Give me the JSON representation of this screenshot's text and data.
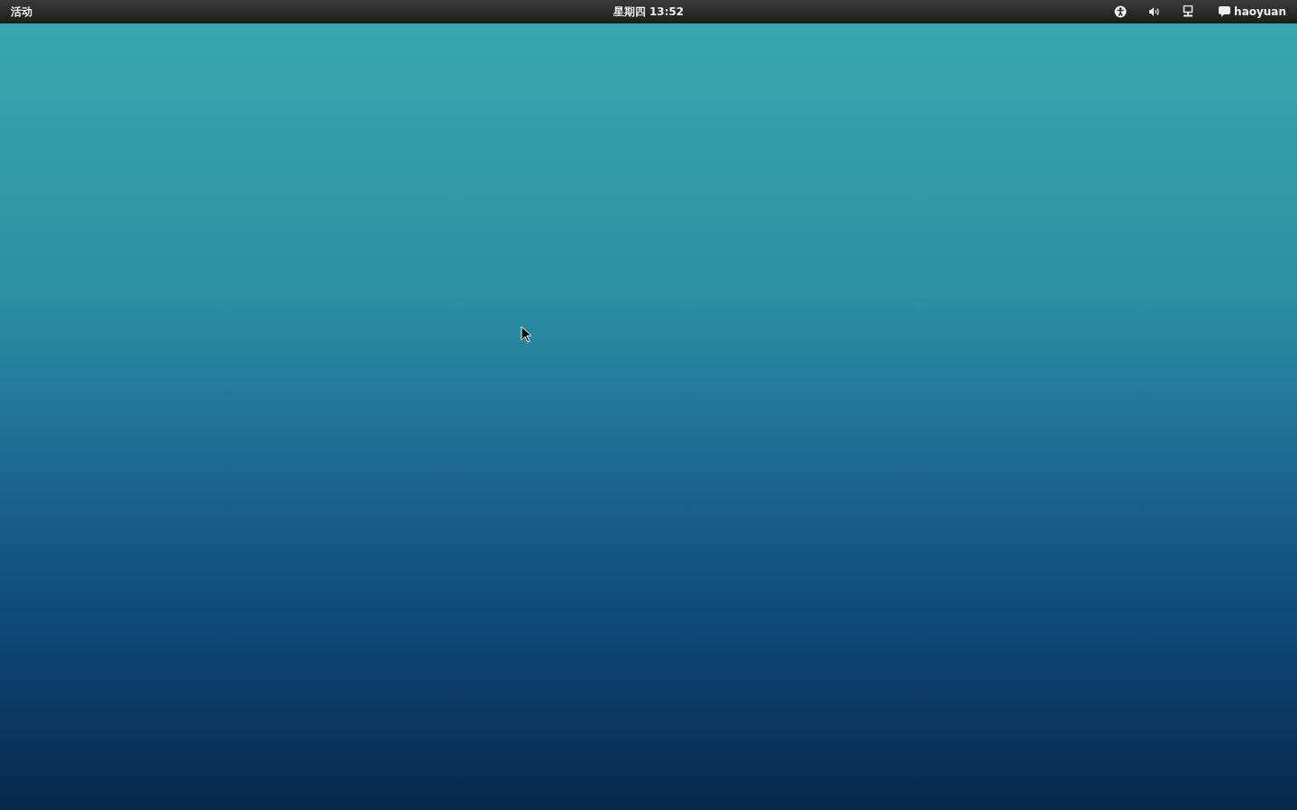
{
  "top_bar": {
    "activities": "活动",
    "clock": "星期四 13:52",
    "user": "haoyuan"
  }
}
